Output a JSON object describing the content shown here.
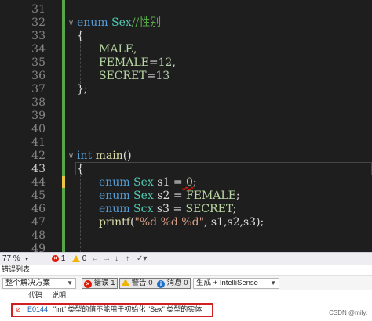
{
  "editor": {
    "line_numbers": [
      "31",
      "32",
      "33",
      "34",
      "35",
      "36",
      "37",
      "38",
      "39",
      "40",
      "41",
      "42",
      "43",
      "44",
      "45",
      "46",
      "47",
      "48",
      "49"
    ],
    "code": {
      "enum_kw": "enum",
      "enum_name": " Sex",
      "enum_comment": "//性别",
      "open_brace": "{",
      "male": "MALE,",
      "female_name": "FEMALE",
      "female_eq": "=",
      "female_val": "12",
      "female_end": ",",
      "secret_name": "SECRET",
      "secret_eq": "=",
      "secret_val": "13",
      "close_enum": "};",
      "int_kw": "int",
      "main_name": " main",
      "main_parens": "()",
      "open_main": "{",
      "l44_kw": "enum",
      "l44_type": " Sex",
      "l44_var": " s1 ",
      "l44_eq": "=",
      "l44_val": " 0",
      "l44_end": ";",
      "l45_kw": "enum",
      "l45_type": " Sex",
      "l45_var": " s2 ",
      "l45_eq": "=",
      "l45_val": " FEMALE",
      "l45_end": ";",
      "l46_kw": "enum",
      "l46_type": " Scx",
      "l46_var": " s3 ",
      "l46_eq": "=",
      "l46_val": " SECRET",
      "l46_end": ";",
      "printf_name": "printf",
      "printf_open": "(",
      "printf_str": "\"%d %d %d\"",
      "printf_args": ", s1,s2,s3);"
    }
  },
  "statusbar": {
    "zoom": "77 %",
    "error_count": "1",
    "warning_count": "0"
  },
  "error_list": {
    "title": "错误列表",
    "scope": "整个解决方案",
    "errors_label": "错误 1",
    "warnings_label": "警告 0",
    "messages_label": "消息 0",
    "build_filter": "生成 + IntelliSense",
    "col_code": "代码",
    "col_desc": "说明",
    "rows": [
      {
        "code": "E0144",
        "description": "\"int\" 类型的值不能用于初始化 \"Sex\" 类型的实体"
      }
    ]
  },
  "watermark": "CSDN @mily.",
  "colors": {
    "editor_bg": "#1e1e1e",
    "keyword": "#569cd6",
    "comment": "#57a64a",
    "error_red": "#e51400",
    "highlight_outline": "#d22020"
  }
}
